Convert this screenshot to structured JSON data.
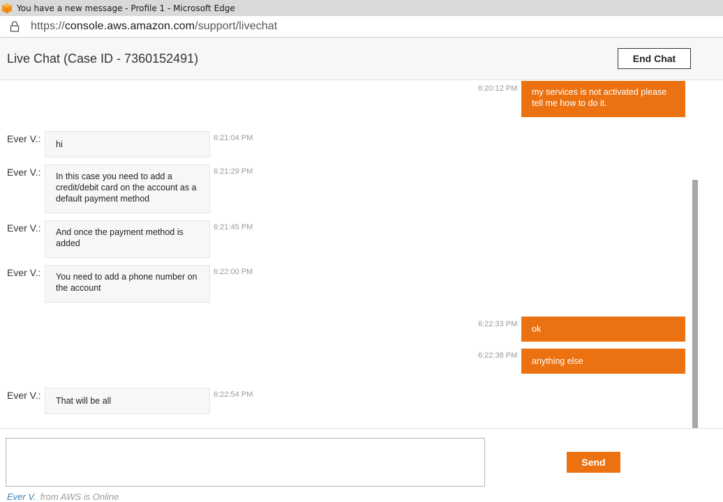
{
  "window": {
    "title": "You have a new message - Profile 1 - Microsoft Edge",
    "icon": "aws-box-icon"
  },
  "address_bar": {
    "url_prefix": "https://",
    "url_host": "console.aws.amazon.com",
    "url_path": "/support/livechat"
  },
  "header": {
    "title": "Live Chat (Case ID - 7360152491)",
    "end_chat_label": "End Chat"
  },
  "messages": [
    {
      "from": "user",
      "time": "6:20:12 PM",
      "text": "my services is not activated please tell me how to do it."
    },
    {
      "from": "agent",
      "name": "Ever V.:",
      "time": "6:21:04 PM",
      "text": "hi"
    },
    {
      "from": "agent",
      "name": "Ever V.:",
      "time": "6:21:29 PM",
      "text": "In this case you need to add a credit/debit card on the account as a default payment method"
    },
    {
      "from": "agent",
      "name": "Ever V.:",
      "time": "6:21:45 PM",
      "text": "And once the payment method is added"
    },
    {
      "from": "agent",
      "name": "Ever V.:",
      "time": "6:22:00 PM",
      "text": "You need to add a phone number on the account"
    },
    {
      "from": "user",
      "time": "6:22:33 PM",
      "text": "ok"
    },
    {
      "from": "user",
      "time": "6:22:38 PM",
      "text": "anything else"
    },
    {
      "from": "agent",
      "name": "Ever V.:",
      "time": "6:22:54 PM",
      "text": "That will be all"
    }
  ],
  "composer": {
    "input_value": "",
    "send_label": "Send"
  },
  "status": {
    "agent": "Ever V.",
    "text": "from AWS is Online"
  },
  "colors": {
    "accent": "#ec7211",
    "agent_bubble": "#f7f7f7",
    "status_agent": "#3d7fb3"
  }
}
